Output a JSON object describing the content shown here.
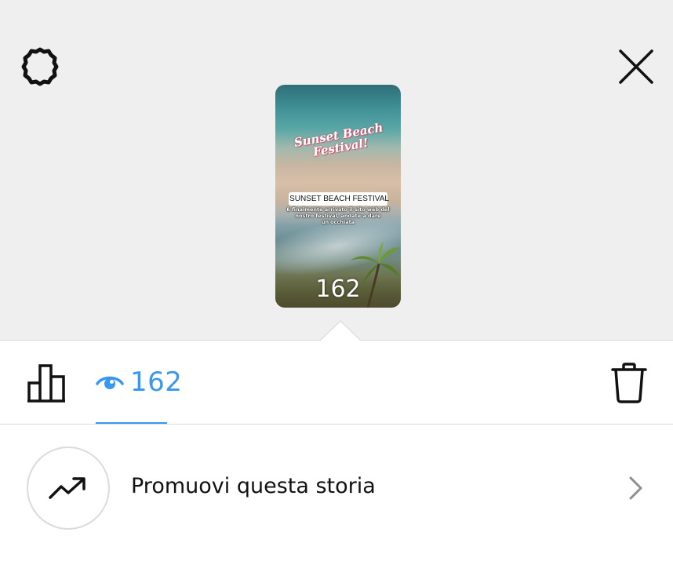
{
  "header": {
    "settings_icon": "gear-icon",
    "close_icon": "close-icon"
  },
  "story": {
    "headline_line1": "Sunset Beach",
    "headline_line2": "Festival!",
    "link_sticker_label": "SUNSET BEACH FESTIVAL",
    "caption": "È finalmente arrivato il sito web del nostro festival, andate a dare un'occhiata",
    "view_count_overlay": "162"
  },
  "insights": {
    "insights_icon": "bar-chart-icon",
    "viewers_icon": "eye-icon",
    "viewers_count": "162",
    "delete_icon": "trash-icon",
    "accent_color": "#3897f0"
  },
  "promote": {
    "icon": "trending-up-icon",
    "label": "Promuovi questa storia",
    "chevron_icon": "chevron-right-icon"
  }
}
